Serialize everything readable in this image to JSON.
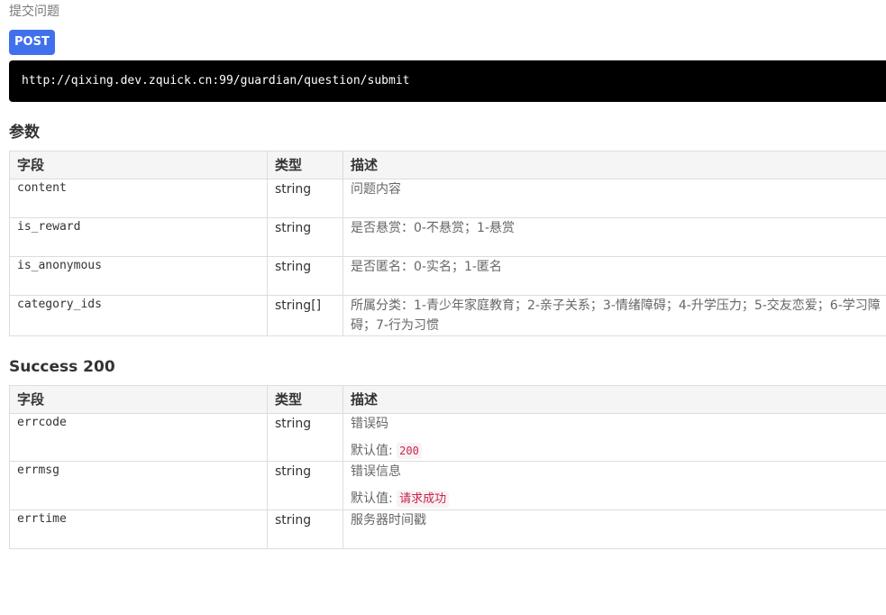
{
  "api": {
    "description": "提交问题",
    "method": "POST",
    "url": "http://qixing.dev.zquick.cn:99/guardian/question/submit"
  },
  "params": {
    "title": "参数",
    "headers": [
      "字段",
      "类型",
      "描述"
    ],
    "rows": [
      {
        "field": "content",
        "type": "string",
        "desc": "问题内容"
      },
      {
        "field": "is_reward",
        "type": "string",
        "desc": "是否悬赏：0-不悬赏；1-悬赏"
      },
      {
        "field": "is_anonymous",
        "type": "string",
        "desc": "是否匿名：0-实名；1-匿名"
      },
      {
        "field": "category_ids",
        "type": "string[]",
        "desc": "所属分类：1-青少年家庭教育；2-亲子关系；3-情绪障碍；4-升学压力；5-交友恋爱；6-学习障碍；7-行为习惯"
      }
    ]
  },
  "success": {
    "title": "Success 200",
    "headers": [
      "字段",
      "类型",
      "描述"
    ],
    "default_label": "默认值:",
    "rows": [
      {
        "field": "errcode",
        "type": "string",
        "desc": "错误码",
        "default": "200"
      },
      {
        "field": "errmsg",
        "type": "string",
        "desc": "错误信息",
        "default": "请求成功"
      },
      {
        "field": "errtime",
        "type": "string",
        "desc": "服务器时间戳"
      }
    ]
  },
  "colors": {
    "method_badge": "#4070ec",
    "url_background": "#000000",
    "default_value_text": "#c7254e",
    "table_header_background": "#f5f5f5"
  }
}
